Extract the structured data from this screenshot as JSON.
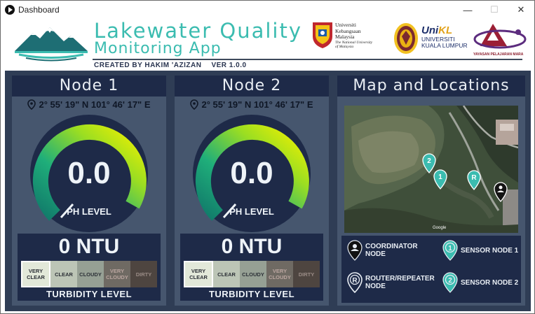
{
  "window": {
    "title": "Dashboard",
    "minimize": "—",
    "maximize": "☐",
    "close": "✕"
  },
  "header": {
    "title_line1": "Lakewater Quality",
    "title_line2": "Monitoring App",
    "credits": "CREATED BY HAKIM 'AZIZAN",
    "version": "VER 1.0.0",
    "logos": {
      "ukm": {
        "line1": "Universiti",
        "line2": "Kebangsaan",
        "line3": "Malaysia",
        "line4": "The National University",
        "line5": "of Malaysia"
      },
      "unikl": {
        "brand_a": "Uni",
        "brand_b": "KL",
        "line1": "UNIVERSITI",
        "line2": "KUALA LUMPUR"
      },
      "ypm": {
        "text": "YAYASAN PELAJARAN MARA"
      }
    }
  },
  "nodes": [
    {
      "title": "Node 1",
      "location": "2° 55' 19\" N 101° 46' 17\" E",
      "ph_value": "0.0",
      "ph_label": "PH LEVEL",
      "ntu": "0 NTU",
      "turbidity_label": "TURBIDITY LEVEL",
      "turbidity_scale": [
        "VERY CLEAR",
        "CLEAR",
        "CLOUDY",
        "VERY CLOUDY",
        "DIRTY"
      ],
      "turbidity_active": "VERY CLEAR"
    },
    {
      "title": "Node 2",
      "location": "2° 55' 19\" N 101° 46' 17\" E",
      "ph_value": "0.0",
      "ph_label": "PH LEVEL",
      "ntu": "0 NTU",
      "turbidity_label": "TURBIDITY LEVEL",
      "turbidity_scale": [
        "VERY CLEAR",
        "CLEAR",
        "CLOUDY",
        "VERY CLOUDY",
        "DIRTY"
      ],
      "turbidity_active": "VERY CLEAR"
    }
  ],
  "map": {
    "title": "Map and Locations",
    "attribution": "Google",
    "markers": [
      "2",
      "1",
      "R"
    ],
    "legend": [
      {
        "icon": "coordinator-icon",
        "label1": "COORDINATOR",
        "label2": "NODE"
      },
      {
        "icon": "sensor-node-1-icon",
        "label1": "SENSOR NODE 1",
        "label2": ""
      },
      {
        "icon": "router-icon",
        "label1": "ROUTER/REPEATER",
        "label2": "NODE"
      },
      {
        "icon": "sensor-node-2-icon",
        "label1": "SENSOR NODE 2",
        "label2": ""
      }
    ]
  },
  "colors": {
    "panel_bg": "#46566e",
    "panel_head": "#1e2a48",
    "accent_teal": "#3bbcb0",
    "gauge_start": "#1aa07e",
    "gauge_end": "#e8f000",
    "scale_very_clear": "#e2e8d9",
    "scale_clear": "#bcc5b6",
    "scale_cloudy": "#96a094",
    "scale_very_cloudy": "#6f6a63",
    "scale_dirty": "#4e4540"
  }
}
